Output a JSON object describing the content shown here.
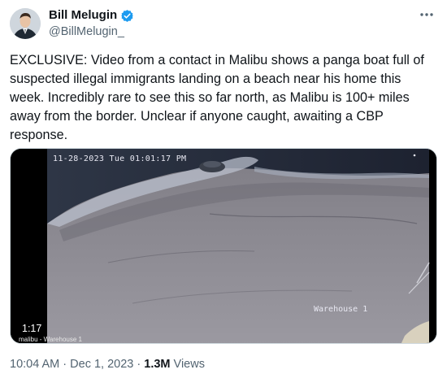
{
  "author": {
    "name": "Bill Melugin",
    "handle": "@BillMelugin_",
    "verified": true,
    "avatar": "portrait-avatar"
  },
  "more_icon": "ellipsis-icon",
  "tweet_text": "EXCLUSIVE: Video from a contact in Malibu shows a panga boat full of suspected illegal immigrants landing on a beach near his home this week. Incredibly rare to see this so far north, as Malibu is 100+ miles away from the border. Unclear if anyone caught, awaiting a CBP response.",
  "media": {
    "osd_timestamp": "11-28-2023 Tue 01:01:17 PM",
    "osd_camera": "Warehouse 1",
    "duration": "1:17",
    "caption": "malibu - Warehouse 1"
  },
  "meta": {
    "time": "10:04 AM",
    "separator1": " · ",
    "date": "Dec 1, 2023",
    "separator2": " · ",
    "views_count": "1.3M",
    "views_label": " Views"
  },
  "colors": {
    "verified": "#1d9bf0",
    "secondary_text": "#536471",
    "primary_text": "#0f1419"
  }
}
